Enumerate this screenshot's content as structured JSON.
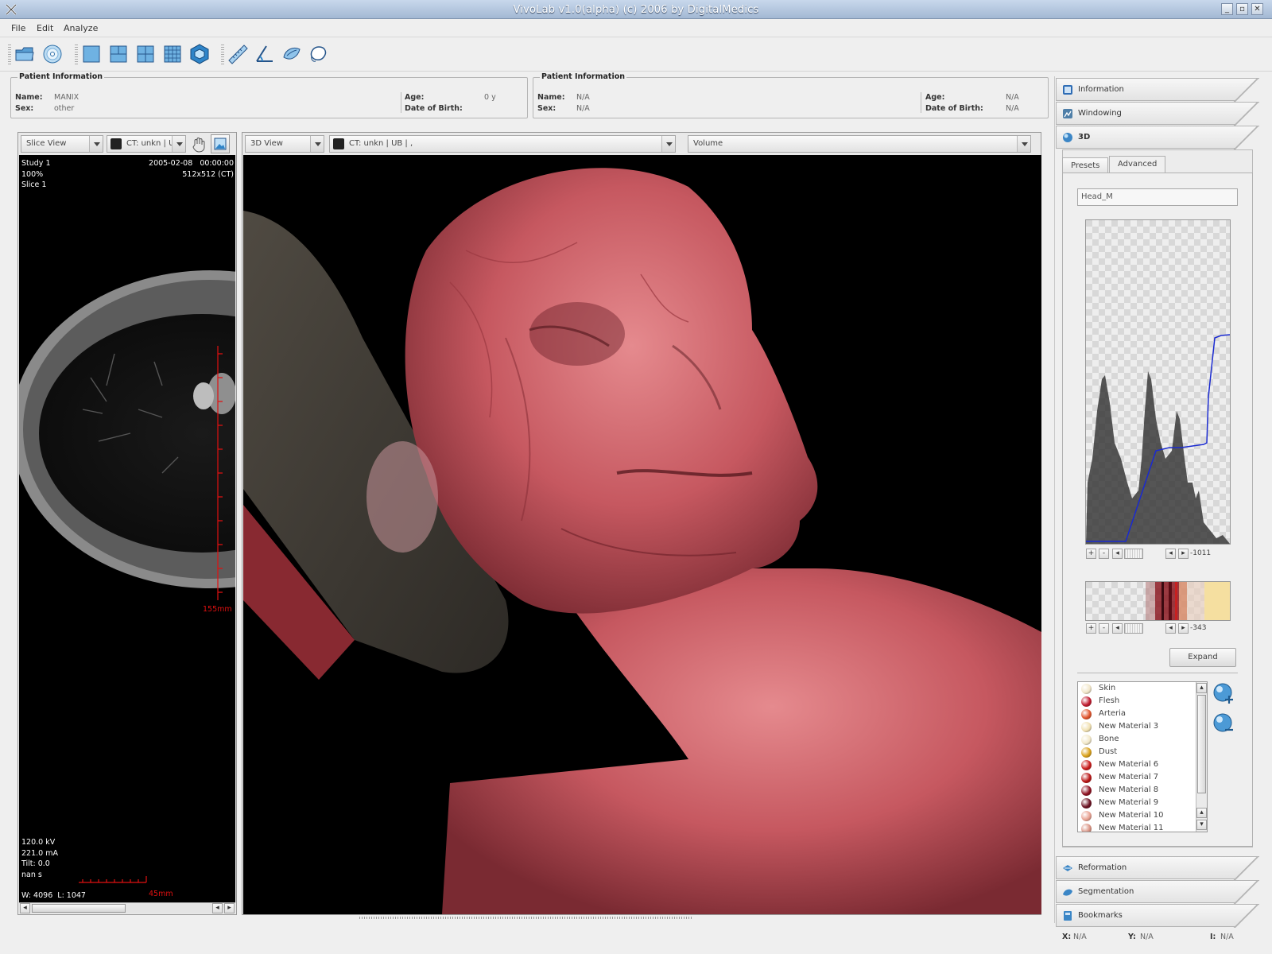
{
  "window": {
    "title": "VivoLab v1.0(alpha)        (c) 2006 by DigitalMedics"
  },
  "menu": [
    {
      "label": "File"
    },
    {
      "label": "Edit"
    },
    {
      "label": "Analyze"
    }
  ],
  "toolbar": {
    "icons": [
      "open-folder-icon",
      "cd-icon",
      "single-layout-icon",
      "three-layout-icon",
      "four-layout-icon",
      "grid-layout-icon",
      "3d-cube-icon",
      "ruler-icon",
      "angle-icon",
      "freehand-icon",
      "lasso-icon"
    ]
  },
  "patient_left": {
    "legend": "Patient Information",
    "name_label": "Name:",
    "name": "MANIX",
    "sex_label": "Sex:",
    "sex": "other",
    "age_label": "Age:",
    "age": "0 y",
    "dob_label": "Date of Birth:",
    "dob": ""
  },
  "patient_right": {
    "legend": "Patient Information",
    "name_label": "Name:",
    "name": "N/A",
    "sex_label": "Sex:",
    "sex": "N/A",
    "age_label": "Age:",
    "age": "N/A",
    "dob_label": "Date of Birth:",
    "dob": "N/A"
  },
  "slice_view": {
    "view_select": "Slice View",
    "series_select": "CT: unkn | U",
    "top_left": [
      "Study 1",
      "100%",
      "Slice 1"
    ],
    "date": "2005-02-08",
    "time": "00:00:00",
    "resolution": "512x512 (CT)",
    "ruler_v": "155mm",
    "ruler_h": "45mm",
    "bottom_left": [
      "120.0 kV",
      "221.0 mA",
      "Tilt: 0.0",
      "nan s"
    ],
    "window_level": "W: 4096  L: 1047"
  },
  "view3d": {
    "view_select": "3D View",
    "series_select": "CT: unkn | UB | ,",
    "mode_select": "Volume"
  },
  "sidebar": {
    "tabs_top": [
      {
        "label": "Information",
        "icon": "info-icon"
      },
      {
        "label": "Windowing",
        "icon": "windowing-icon"
      },
      {
        "label": "3D",
        "icon": "sphere-icon"
      }
    ],
    "subtabs": [
      {
        "label": "Presets"
      },
      {
        "label": "Advanced"
      }
    ],
    "preset_name": "Head_M",
    "histogram_value": "-1011",
    "colormap_value": "-343",
    "expand_label": "Expand",
    "materials": [
      {
        "name": "Skin",
        "color": "#f1e6c8"
      },
      {
        "name": "Flesh",
        "color": "#c0182c"
      },
      {
        "name": "Arteria",
        "color": "#e0522a"
      },
      {
        "name": "New Material 3",
        "color": "#f0e0b0"
      },
      {
        "name": "Bone",
        "color": "#f2e8c8"
      },
      {
        "name": "Dust",
        "color": "#d9a018"
      },
      {
        "name": "New Material 6",
        "color": "#c81818"
      },
      {
        "name": "New Material 7",
        "color": "#b81414"
      },
      {
        "name": "New Material 8",
        "color": "#8e1020"
      },
      {
        "name": "New Material 9",
        "color": "#6a1020"
      },
      {
        "name": "New Material 10",
        "color": "#e8a090"
      },
      {
        "name": "New Material 11",
        "color": "#d89080"
      }
    ],
    "tabs_bottom": [
      {
        "label": "Reformation",
        "icon": "reformation-icon"
      },
      {
        "label": "Segmentation",
        "icon": "segmentation-icon"
      },
      {
        "label": "Bookmarks",
        "icon": "bookmarks-icon"
      }
    ]
  },
  "status": {
    "x_label": "X:",
    "x": "N/A",
    "y_label": "Y:",
    "y": "N/A",
    "i_label": "I:",
    "i": "N/A"
  },
  "colors": {
    "accent": "#2f6db5",
    "curve": "#1a2ad0",
    "ruler": "#e01010"
  }
}
